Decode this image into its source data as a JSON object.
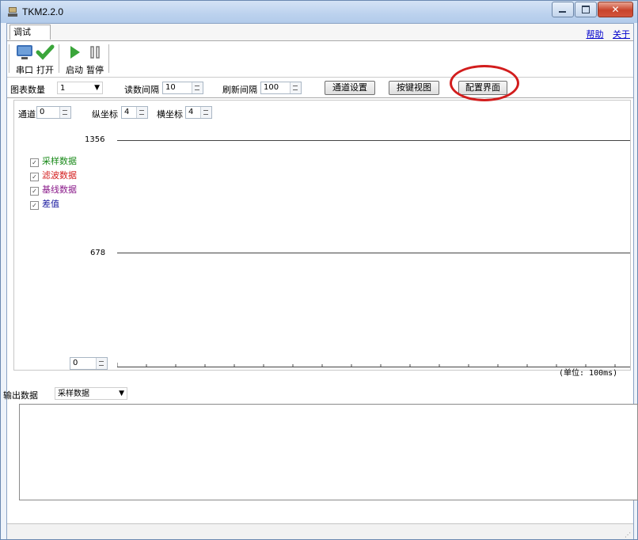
{
  "window": {
    "title": "TKM2.2.0"
  },
  "tab": {
    "label": "调试"
  },
  "links": {
    "help": "帮助",
    "about": "关于"
  },
  "toolbar": {
    "serial": "串口",
    "open": "打开",
    "start": "启动",
    "pause": "暂停"
  },
  "settings": {
    "chart_count_label": "图表数量",
    "chart_count_value": "1",
    "read_interval_label": "读数间隔",
    "read_interval_value": "10",
    "refresh_interval_label": "刷新间隔",
    "refresh_interval_value": "100",
    "channel_settings_btn": "通道设置",
    "key_view_btn": "按键视图",
    "config_btn": "配置界面"
  },
  "chart": {
    "channel_label": "通道",
    "channel_value": "0",
    "y_axis_label": "纵坐标",
    "y_axis_value": "4",
    "x_axis_label": "横坐标",
    "x_axis_value": "4",
    "series": [
      {
        "label": "采样数据",
        "color": "#1a8a1a",
        "checked": true
      },
      {
        "label": "滤波数据",
        "color": "#d42020",
        "checked": true
      },
      {
        "label": "基线数据",
        "color": "#8a1a8a",
        "checked": true
      },
      {
        "label": "差值",
        "color": "#1a1aa0",
        "checked": true
      }
    ],
    "y_top": "1356",
    "y_mid": "678",
    "y_min_value": "0",
    "unit": "(单位: 100ms)"
  },
  "output": {
    "label": "输出数据",
    "select_value": "采样数据"
  },
  "colors": {
    "annotation": "#d21d1d"
  }
}
